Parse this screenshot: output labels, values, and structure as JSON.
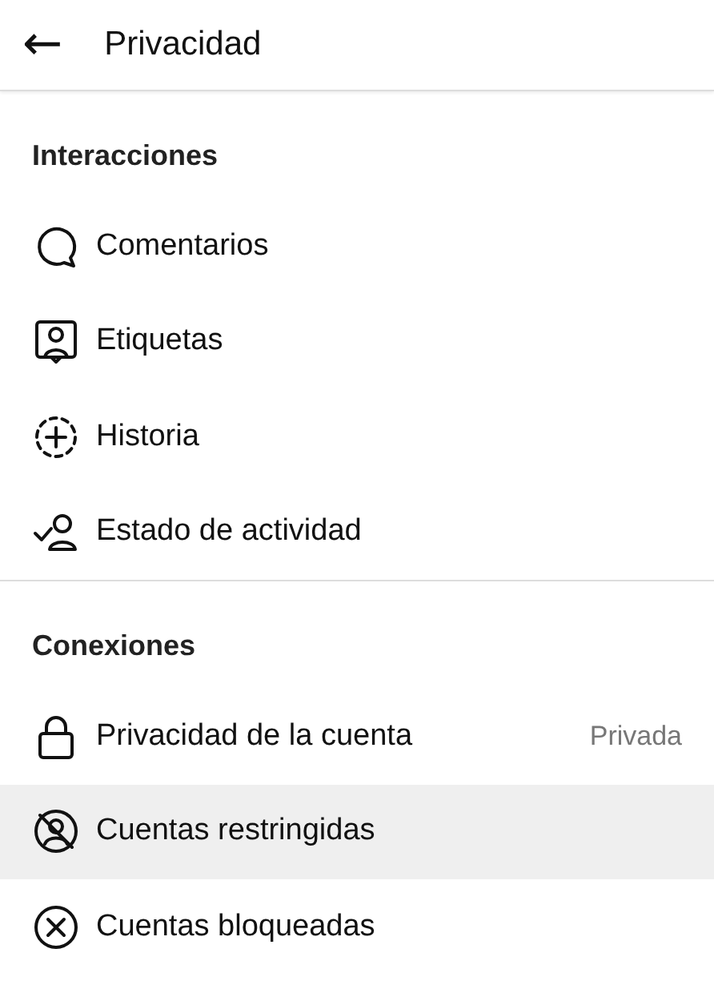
{
  "header": {
    "back": "←",
    "title": "Privacidad"
  },
  "sections": [
    {
      "title": "Interacciones",
      "items": [
        {
          "kind": "comment",
          "label": "Comentarios",
          "selected": false
        },
        {
          "kind": "tag",
          "label": "Etiquetas",
          "selected": false
        },
        {
          "kind": "story",
          "label": "Historia",
          "selected": false
        },
        {
          "kind": "activity",
          "label": "Estado de actividad",
          "selected": false
        }
      ]
    },
    {
      "title": "Conexiones",
      "items": [
        {
          "kind": "lock",
          "label": "Privacidad de la cuenta",
          "value": "Privada",
          "selected": false
        },
        {
          "kind": "restricted",
          "label": "Cuentas restringidas",
          "selected": true
        },
        {
          "kind": "blocked",
          "label": "Cuentas bloqueadas",
          "selected": false
        }
      ]
    }
  ]
}
